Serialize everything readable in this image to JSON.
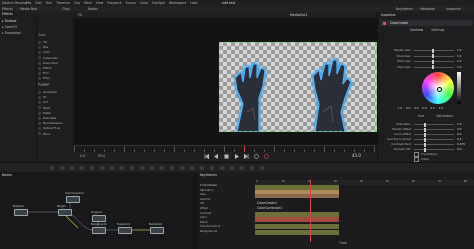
{
  "menu": {
    "app": "DaVinci Resolve",
    "items": [
      "File",
      "Edit",
      "Trim",
      "Timeline",
      "Clip",
      "Mark",
      "View",
      "Playback",
      "Fusion",
      "Color",
      "Fairlight",
      "Workspace",
      "Help"
    ],
    "title": "edit test",
    "effects_label": "Effects",
    "keyframes_label": "Keyframes",
    "metadata_label": "Metadata",
    "inspector_label": "Inspector"
  },
  "toolbar": {
    "media_pool": "Media Pool",
    "clips": "Clips",
    "nodes": "Nodes"
  },
  "left": {
    "header": "Effects",
    "tree": [
      "Toolbox",
      "OpenFX",
      "Templates"
    ],
    "tool_headers": [
      "Tools",
      "Fusion"
    ],
    "tool_rows_a": [
      "3D",
      "Blur",
      "Color",
      "Composite",
      "Deep Pixel",
      "Effect",
      "Film",
      "Filter",
      "Flow"
    ],
    "tool_rows_b": [
      "Generator",
      "IO",
      "LUT",
      "Mask",
      "Matte",
      "Metadata",
      "Miscellaneous",
      "Optical Flow",
      "Paint"
    ]
  },
  "viewer": {
    "title": "MediaOut1",
    "zoom": "Fit",
    "frame": "43.0",
    "start": "0.0",
    "end": "95.0"
  },
  "inspector": {
    "title": "Inspector",
    "node_name": "ColorGrade",
    "tab_a": "Controls",
    "tab_b": "Settings",
    "rows": [
      {
        "label": "Master Gain",
        "value": "1.0"
      },
      {
        "label": "Shad Gain",
        "value": "1.0"
      },
      {
        "label": "Mids Gain",
        "value": "1.0"
      },
      {
        "label": "High Gain",
        "value": "1.0"
      }
    ],
    "wheel_values": [
      "1.0",
      "0.0",
      "0.0",
      "0.0",
      "0.0",
      "1.0"
    ],
    "wheel_labels": [
      "Hue",
      "Saturation"
    ],
    "params": [
      {
        "label": "Saturation",
        "value": "1.0"
      },
      {
        "label": "Master Offset",
        "value": "0.0"
      },
      {
        "label": "Luma Offset",
        "value": "0.0"
      },
      {
        "label": "Gamma Contrast",
        "value": "0.0"
      },
      {
        "label": "Contrast Pivot",
        "value": "0.435"
      },
      {
        "label": "Sharpen Mix",
        "value": "0.0"
      }
    ],
    "check_a": "Pre-Multiply",
    "check_b": "Alpha",
    "params2": [
      {
        "label": "Vertical Spread",
        "value": "0.5"
      },
      {
        "label": "Color Blend",
        "value": "1.0"
      }
    ],
    "check_c": "Retain Blend"
  },
  "nodes": {
    "title": "Nodes",
    "list": [
      "MediaIn1",
      "Merge1",
      "ColorCorrector1",
      "Background1",
      "MediaOut1",
      "Polygon1",
      "Transform1"
    ]
  },
  "keyframes": {
    "title": "Keyframes",
    "layers": [
      "ColorGrade",
      "Saturation",
      "Gain",
      "Gamma",
      "Lift",
      "Offset",
      "Contrast",
      "Color",
      "Blend",
      "ColorCorrector1",
      "Background1"
    ],
    "ruler": [
      "0",
      "10",
      "20",
      "30",
      "40",
      "50",
      "60",
      "70",
      "80"
    ],
    "label_a": "ColorGrade1",
    "label_b": "ColorCorrector1",
    "footer": "Time"
  },
  "colors": {
    "accent": "#e25a5a",
    "playhead": "#d14646",
    "track_olive": "#6e7039",
    "track_peach": "#b08b5d",
    "track_red": "#a34a3f"
  }
}
